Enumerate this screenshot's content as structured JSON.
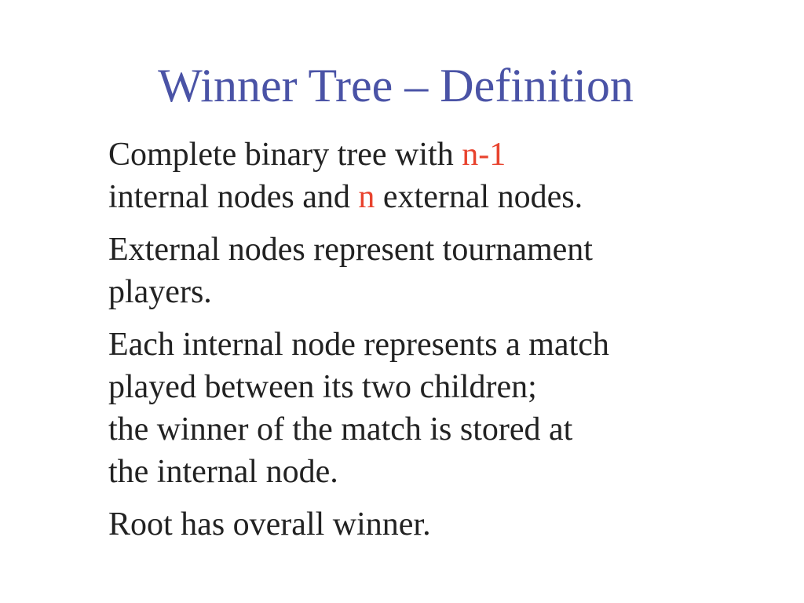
{
  "title": "Winner Tree – Definition",
  "accent_color": "#4a53a6",
  "highlight_color": "#e8432e",
  "paragraphs": [
    {
      "line1": {
        "before": "Complete binary tree with ",
        "hl": "n-1"
      },
      "line2": {
        "before": "internal nodes and ",
        "hl": "n",
        "after": " external nodes."
      }
    },
    {
      "lines": [
        "External nodes represent tournament",
        "players."
      ]
    },
    {
      "lines": [
        "Each internal node represents a match",
        "played between its two children;",
        "the winner of the match is stored at",
        "the internal node."
      ]
    },
    {
      "lines": [
        "Root has overall winner."
      ]
    }
  ]
}
